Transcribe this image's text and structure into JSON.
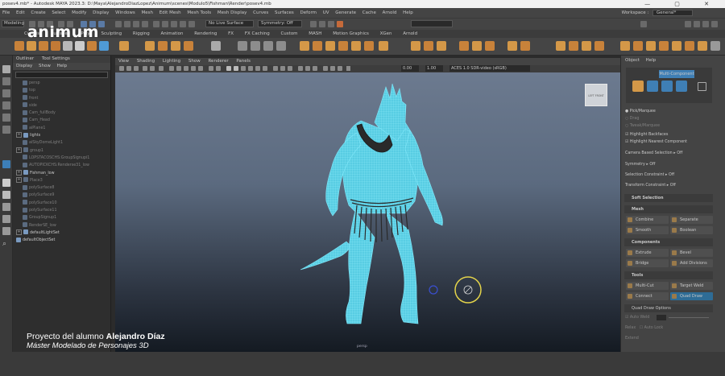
{
  "window": {
    "title": "posev4.mb* - Autodesk MAYA 2023.3: D:\\Maya\\AlejandroDiazLopez\\Animum\\scenes\\Modulo5\\Fishman\\Render\\posev4.mb",
    "controls": "—  ▢  ✕"
  },
  "menubar": [
    "File",
    "Edit",
    "Create",
    "Select",
    "Modify",
    "Display",
    "Windows",
    "Mesh",
    "Edit Mesh",
    "Mesh Tools",
    "Mesh Display",
    "Curves",
    "Surfaces",
    "Deform",
    "UV",
    "Generate",
    "Cache",
    "Arnold",
    "Help"
  ],
  "workspace": {
    "label": "Workspace :",
    "value": "General*"
  },
  "statusline": {
    "mode": "Modeling",
    "surface": "No Live Surface",
    "symmetry": "Symmetry: Off"
  },
  "shelf_tabs": [
    "Curves",
    "Surfaces",
    "Poly",
    "Sculpting",
    "Rigging",
    "Animation",
    "Rendering",
    "FX",
    "FX Caching",
    "Custom",
    "MASH",
    "Motion Graphics",
    "XGen",
    "Arnold"
  ],
  "brand": "animum",
  "outliner": {
    "tabs": [
      "Outliner",
      "Tool Settings"
    ],
    "menus": [
      "Display",
      "Show",
      "Help"
    ],
    "items": [
      {
        "label": "persp",
        "dim": true,
        "indent": 1
      },
      {
        "label": "top",
        "dim": true,
        "indent": 1
      },
      {
        "label": "front",
        "dim": true,
        "indent": 1
      },
      {
        "label": "side",
        "dim": true,
        "indent": 1
      },
      {
        "label": "Cam_fullBody",
        "dim": true,
        "indent": 1
      },
      {
        "label": "Cam_Head",
        "dim": true,
        "indent": 1
      },
      {
        "label": "aiPlane1",
        "dim": true,
        "indent": 1
      },
      {
        "label": "lights",
        "dim": false,
        "indent": 0,
        "expand": true
      },
      {
        "label": "aiSkyDomeLight1",
        "dim": true,
        "indent": 1
      },
      {
        "label": "group1",
        "dim": true,
        "indent": 0,
        "expand": true
      },
      {
        "label": "LOPSTACOSCHS:GroupSignupi1",
        "dim": true,
        "indent": 1
      },
      {
        "label": "AUTOPICKCHS:Renderse31_low",
        "dim": true,
        "indent": 1
      },
      {
        "label": "Fishman_low",
        "dim": false,
        "indent": 0,
        "expand": true
      },
      {
        "label": "Place3",
        "dim": true,
        "indent": 0,
        "expand": true
      },
      {
        "label": "polySurface8",
        "dim": true,
        "indent": 1
      },
      {
        "label": "polySurface9",
        "dim": true,
        "indent": 1
      },
      {
        "label": "polySurface10",
        "dim": true,
        "indent": 1
      },
      {
        "label": "polySurface11",
        "dim": true,
        "indent": 1
      },
      {
        "label": "GroupSignup1",
        "dim": true,
        "indent": 1
      },
      {
        "label": "RenderSE_low",
        "dim": true,
        "indent": 1
      },
      {
        "label": "defaultLightSet",
        "dim": false,
        "indent": 0,
        "expand": true
      },
      {
        "label": "defaultObjectSet",
        "dim": false,
        "indent": 0
      }
    ]
  },
  "viewport": {
    "menus": [
      "View",
      "Shading",
      "Lighting",
      "Show",
      "Renderer",
      "Panels"
    ],
    "field1": "0.00",
    "field2": "1.00",
    "colorspace": "ACES 1.0 SDR-video (sRGB)",
    "viewcube": "LEFT FRONT",
    "camera_label": "persp"
  },
  "rightpanel": {
    "tabs": [
      "Object",
      "Help"
    ],
    "header": "Multi-Component",
    "pick": [
      {
        "label": "Pick/Marquee",
        "selected": true
      },
      {
        "label": "Drag",
        "selected": false
      },
      {
        "label": "Tweak/Marquee",
        "selected": false
      }
    ],
    "checks": [
      "Highlight Backfaces",
      "Highlight Nearest Component"
    ],
    "settings": [
      {
        "label": "Camera Based Selection",
        "value": "Off"
      },
      {
        "label": "Symmetry",
        "value": "Off"
      },
      {
        "label": "Selection Constraint",
        "value": "Off"
      },
      {
        "label": "Transform Constraint",
        "value": "Off"
      }
    ],
    "soft_selection": "Soft Selection",
    "sections": {
      "mesh": "Mesh",
      "components": "Components",
      "tools": "Tools",
      "quad_draw": "Quad Draw Options"
    },
    "mesh_buttons": [
      "Combine",
      "Separate",
      "Smooth",
      "Boolean"
    ],
    "component_buttons": [
      "Extrude",
      "Bevel",
      "Bridge",
      "Add Divisions"
    ],
    "tool_buttons": [
      "Multi-Cut",
      "Target Weld",
      "Connect",
      "Quad Draw"
    ],
    "quad_rows": [
      "Auto Weld",
      "Relax",
      "Extend"
    ],
    "quad_row_values": [
      "",
      "Auto Lock",
      ""
    ]
  },
  "caption": {
    "line1_prefix": "Proyecto del alumno ",
    "line1_name": "Alejandro Díaz",
    "line2": "Máster Modelado de Personajes 3D"
  },
  "colors": {
    "wire": "#6fe3f5",
    "highlight": "#4fa3d9",
    "quad_draw_active": "#2e6c96",
    "cursor": "#e3d34a"
  }
}
